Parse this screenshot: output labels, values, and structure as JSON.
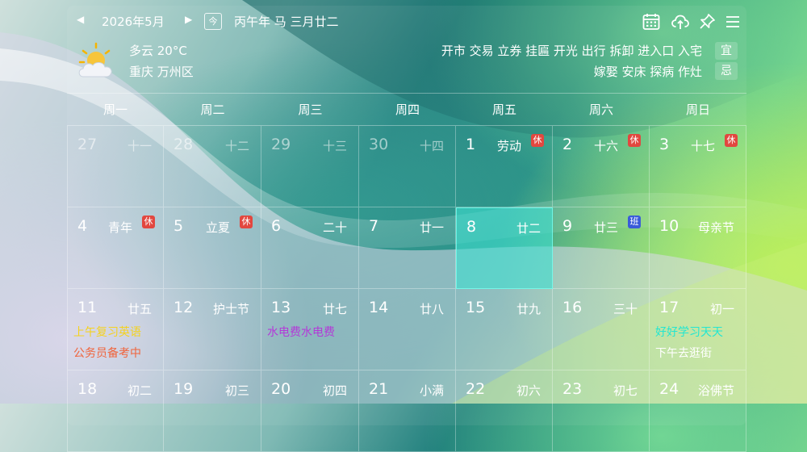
{
  "header": {
    "month_title": "2026年5月",
    "today_label": "今",
    "lunar_title": "丙午年 马 三月廿二"
  },
  "weather": {
    "condition_temp": "多云 20°C",
    "location": "重庆 万州区"
  },
  "almanac": {
    "yi": "开市 交易 立券 挂匾 开光 出行 拆卸 进入口 入宅",
    "yi_label": "宜",
    "ji": "嫁娶 安床 探病 作灶",
    "ji_label": "忌"
  },
  "colors": {
    "rest_badge": "#e2473f",
    "work_badge": "#3a5bd9",
    "today_highlight": "#40e0d0"
  },
  "weekdays": [
    "周一",
    "周二",
    "周三",
    "周四",
    "周五",
    "周六",
    "周日"
  ],
  "days": [
    {
      "date": "27",
      "lunar": "十一",
      "other": true
    },
    {
      "date": "28",
      "lunar": "十二",
      "other": true
    },
    {
      "date": "29",
      "lunar": "十三",
      "other": true
    },
    {
      "date": "30",
      "lunar": "十四",
      "other": true
    },
    {
      "date": "1",
      "lunar": "劳动",
      "badge": "休"
    },
    {
      "date": "2",
      "lunar": "十六",
      "badge": "休"
    },
    {
      "date": "3",
      "lunar": "十七",
      "badge": "休"
    },
    {
      "date": "4",
      "lunar": "青年",
      "badge": "休"
    },
    {
      "date": "5",
      "lunar": "立夏",
      "badge": "休"
    },
    {
      "date": "6",
      "lunar": "二十"
    },
    {
      "date": "7",
      "lunar": "廿一"
    },
    {
      "date": "8",
      "lunar": "廿二",
      "today": true
    },
    {
      "date": "9",
      "lunar": "廿三",
      "badge": "班"
    },
    {
      "date": "10",
      "lunar": "母亲节"
    },
    {
      "date": "11",
      "lunar": "廿五",
      "notes": [
        {
          "text": "上午复习英语",
          "color": "#f5d21e"
        },
        {
          "text": "公务员备考中",
          "color": "#f0643c"
        }
      ]
    },
    {
      "date": "12",
      "lunar": "护士节"
    },
    {
      "date": "13",
      "lunar": "廿七",
      "notes": [
        {
          "text": "水电费水电费",
          "color": "#b33ad8"
        }
      ]
    },
    {
      "date": "14",
      "lunar": "廿八"
    },
    {
      "date": "15",
      "lunar": "廿九"
    },
    {
      "date": "16",
      "lunar": "三十"
    },
    {
      "date": "17",
      "lunar": "初一",
      "notes": [
        {
          "text": "好好学习天天",
          "color": "#22e6d2"
        },
        {
          "text": "下午去逛街",
          "color": "#ffffff"
        }
      ]
    },
    {
      "date": "18",
      "lunar": "初二"
    },
    {
      "date": "19",
      "lunar": "初三"
    },
    {
      "date": "20",
      "lunar": "初四"
    },
    {
      "date": "21",
      "lunar": "小满"
    },
    {
      "date": "22",
      "lunar": "初六"
    },
    {
      "date": "23",
      "lunar": "初七"
    },
    {
      "date": "24",
      "lunar": "浴佛节"
    }
  ]
}
